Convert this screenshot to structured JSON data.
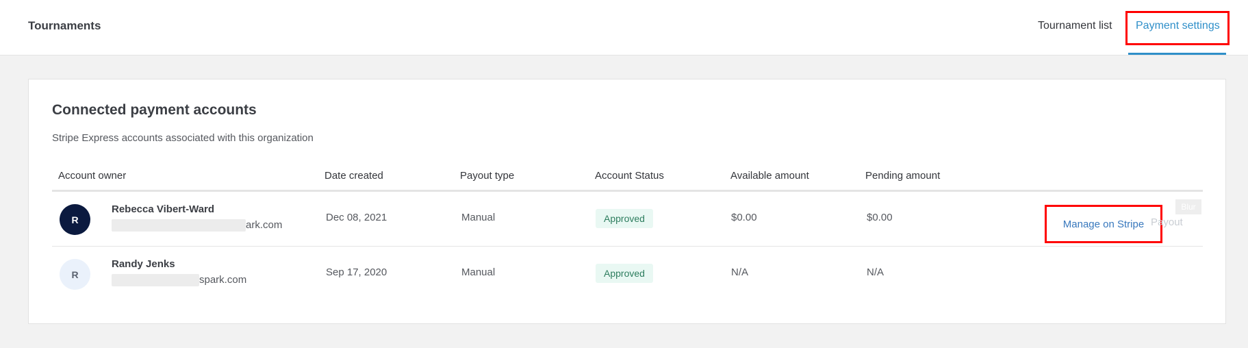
{
  "header": {
    "app_title": "Tournaments",
    "tabs": [
      {
        "label": "Tournament list",
        "active": false
      },
      {
        "label": "Payment settings",
        "active": true
      }
    ]
  },
  "accounts": {
    "title": "Connected payment accounts",
    "subtitle": "Stripe Express accounts associated with this organization",
    "columns": [
      "Account owner",
      "Date created",
      "Payout type",
      "Account Status",
      "Available amount",
      "Pending amount"
    ],
    "rows": [
      {
        "initial": "R",
        "name": "Rebecca Vibert-Ward",
        "email_suffix": "ark.com",
        "date_created": "Dec 08, 2021",
        "payout_type": "Manual",
        "status": "Approved",
        "available": "$0.00",
        "pending": "$0.00",
        "manage_label": "Manage on Stripe",
        "payout_label": "Payout",
        "tag_label": "Blur"
      },
      {
        "initial": "R",
        "name": "Randy Jenks",
        "email_suffix": "spark.com",
        "date_created": "Sep 17, 2020",
        "payout_type": "Manual",
        "status": "Approved",
        "available": "N/A",
        "pending": "N/A"
      }
    ]
  },
  "colors": {
    "accent": "#2f8fc9",
    "link": "#3878bd",
    "highlight": "#ff0000",
    "approved_bg": "#e9f8f3",
    "approved_text": "#2d7d5e",
    "avatar_dark": "#0b1a3f"
  }
}
